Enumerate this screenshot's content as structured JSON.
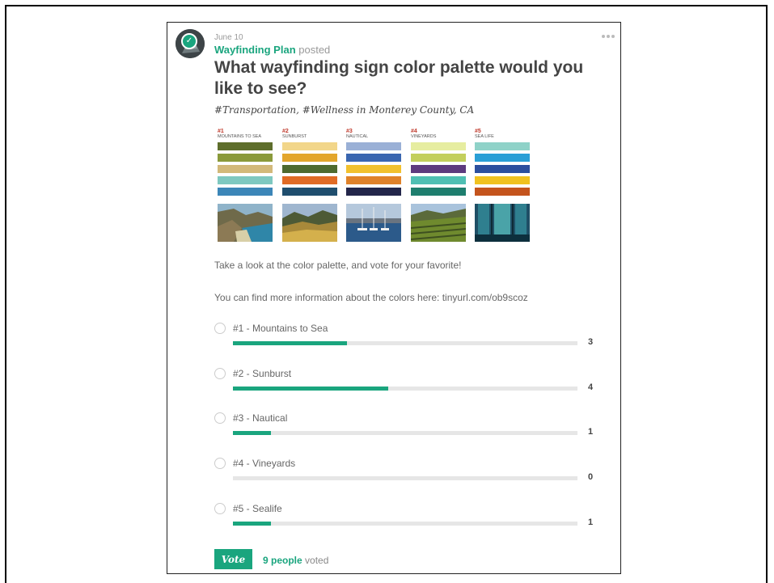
{
  "post": {
    "date": "June 10",
    "author": "Wayfinding Plan",
    "action": " posted",
    "title": "What wayfinding sign color palette would you like to see?",
    "tags": "#Transportation, #Wellness",
    "location_prefix": "in",
    "location": "Monterey County, CA",
    "description_1": "Take a look at the color palette, and vote for your favorite!",
    "description_2": "You can find more information about the colors here: tinyurl.com/ob9scoz"
  },
  "palettes": [
    {
      "number": "#1",
      "name": "MOUNTAINS TO SEA",
      "colors": [
        "#5e6e2c",
        "#8a9a3b",
        "#d2b97a",
        "#7ec8c0",
        "#3c86b8"
      ],
      "photo": "coast"
    },
    {
      "number": "#2",
      "name": "SUNBURST",
      "colors": [
        "#f2d68a",
        "#e3a62c",
        "#4e6a2f",
        "#e06b25",
        "#1f4e6e"
      ],
      "photo": "hills"
    },
    {
      "number": "#3",
      "name": "NAUTICAL",
      "colors": [
        "#9ab0d6",
        "#3a66b0",
        "#f2c12e",
        "#e0822a",
        "#23264a"
      ],
      "photo": "harbor"
    },
    {
      "number": "#4",
      "name": "VINEYARDS",
      "colors": [
        "#e6eda0",
        "#c3cf5c",
        "#5d3a7e",
        "#4fbfb3",
        "#1e7e6e"
      ],
      "photo": "vineyard"
    },
    {
      "number": "#5",
      "name": "SEA LIFE",
      "colors": [
        "#8fd2c8",
        "#2a9fd6",
        "#2b4f9e",
        "#f0c220",
        "#c4541d"
      ],
      "photo": "aquarium"
    }
  ],
  "poll": {
    "options": [
      {
        "label": "#1 - Mountains to Sea",
        "votes": 3,
        "fraction": 0.33
      },
      {
        "label": "#2 - Sunburst",
        "votes": 4,
        "fraction": 0.45
      },
      {
        "label": "#3 - Nautical",
        "votes": 1,
        "fraction": 0.11
      },
      {
        "label": "#4 - Vineyards",
        "votes": 0,
        "fraction": 0
      },
      {
        "label": "#5 - Sealife",
        "votes": 1,
        "fraction": 0.11
      }
    ],
    "vote_label": "Vote",
    "voted_count": "9 people",
    "voted_suffix": " voted"
  },
  "colors": {
    "accent": "#1aa57e",
    "track": "#e6e6e6"
  },
  "icons": {
    "avatar_badge": "checkmark-icon",
    "more": "more-dots-icon"
  }
}
